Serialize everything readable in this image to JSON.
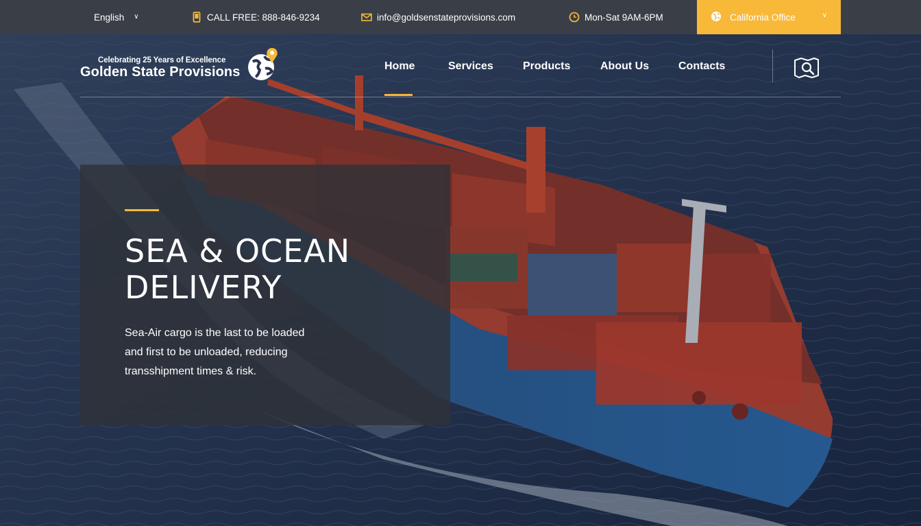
{
  "topbar": {
    "language": "English",
    "phone": "CALL FREE: 888-846-9234",
    "email": "info@goldsenstateprovisions.com",
    "hours": "Mon-Sat 9AM-6PM",
    "office": "California Office",
    "icons": [
      "phone-icon",
      "mail-icon",
      "clock-icon",
      "globe-icon",
      "chevron-down-icon"
    ]
  },
  "logo": {
    "tagline": "Celebrating 25 Years of Excellence",
    "name": "Golden State Provisions",
    "icon": "globe-pin-icon"
  },
  "nav": {
    "items": [
      "Home",
      "Services",
      "Products",
      "About Us",
      "Contacts"
    ],
    "active": "Home",
    "map_icon": "map-search-icon"
  },
  "hero": {
    "title_line1": "SEA & OCEAN",
    "title_line2": "DELIVERY",
    "text": "Sea-Air cargo is the last to be loaded and first to be unloaded, reducing transshipment times & risk."
  },
  "colors": {
    "accent": "#f8b838",
    "topbar": "#3a3f47",
    "card": "#303238"
  }
}
